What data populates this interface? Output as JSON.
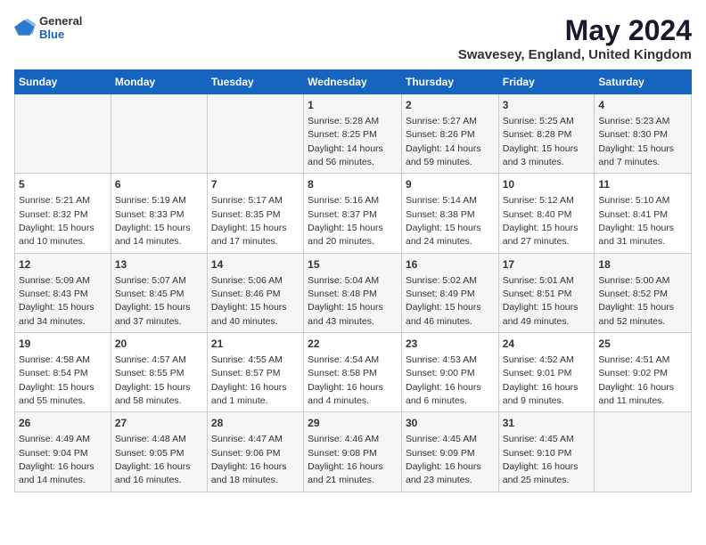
{
  "logo": {
    "general": "General",
    "blue": "Blue"
  },
  "header": {
    "month": "May 2024",
    "location": "Swavesey, England, United Kingdom"
  },
  "weekdays": [
    "Sunday",
    "Monday",
    "Tuesday",
    "Wednesday",
    "Thursday",
    "Friday",
    "Saturday"
  ],
  "weeks": [
    [
      {
        "day": "",
        "info": ""
      },
      {
        "day": "",
        "info": ""
      },
      {
        "day": "",
        "info": ""
      },
      {
        "day": "1",
        "info": "Sunrise: 5:28 AM\nSunset: 8:25 PM\nDaylight: 14 hours and 56 minutes."
      },
      {
        "day": "2",
        "info": "Sunrise: 5:27 AM\nSunset: 8:26 PM\nDaylight: 14 hours and 59 minutes."
      },
      {
        "day": "3",
        "info": "Sunrise: 5:25 AM\nSunset: 8:28 PM\nDaylight: 15 hours and 3 minutes."
      },
      {
        "day": "4",
        "info": "Sunrise: 5:23 AM\nSunset: 8:30 PM\nDaylight: 15 hours and 7 minutes."
      }
    ],
    [
      {
        "day": "5",
        "info": "Sunrise: 5:21 AM\nSunset: 8:32 PM\nDaylight: 15 hours and 10 minutes."
      },
      {
        "day": "6",
        "info": "Sunrise: 5:19 AM\nSunset: 8:33 PM\nDaylight: 15 hours and 14 minutes."
      },
      {
        "day": "7",
        "info": "Sunrise: 5:17 AM\nSunset: 8:35 PM\nDaylight: 15 hours and 17 minutes."
      },
      {
        "day": "8",
        "info": "Sunrise: 5:16 AM\nSunset: 8:37 PM\nDaylight: 15 hours and 20 minutes."
      },
      {
        "day": "9",
        "info": "Sunrise: 5:14 AM\nSunset: 8:38 PM\nDaylight: 15 hours and 24 minutes."
      },
      {
        "day": "10",
        "info": "Sunrise: 5:12 AM\nSunset: 8:40 PM\nDaylight: 15 hours and 27 minutes."
      },
      {
        "day": "11",
        "info": "Sunrise: 5:10 AM\nSunset: 8:41 PM\nDaylight: 15 hours and 31 minutes."
      }
    ],
    [
      {
        "day": "12",
        "info": "Sunrise: 5:09 AM\nSunset: 8:43 PM\nDaylight: 15 hours and 34 minutes."
      },
      {
        "day": "13",
        "info": "Sunrise: 5:07 AM\nSunset: 8:45 PM\nDaylight: 15 hours and 37 minutes."
      },
      {
        "day": "14",
        "info": "Sunrise: 5:06 AM\nSunset: 8:46 PM\nDaylight: 15 hours and 40 minutes."
      },
      {
        "day": "15",
        "info": "Sunrise: 5:04 AM\nSunset: 8:48 PM\nDaylight: 15 hours and 43 minutes."
      },
      {
        "day": "16",
        "info": "Sunrise: 5:02 AM\nSunset: 8:49 PM\nDaylight: 15 hours and 46 minutes."
      },
      {
        "day": "17",
        "info": "Sunrise: 5:01 AM\nSunset: 8:51 PM\nDaylight: 15 hours and 49 minutes."
      },
      {
        "day": "18",
        "info": "Sunrise: 5:00 AM\nSunset: 8:52 PM\nDaylight: 15 hours and 52 minutes."
      }
    ],
    [
      {
        "day": "19",
        "info": "Sunrise: 4:58 AM\nSunset: 8:54 PM\nDaylight: 15 hours and 55 minutes."
      },
      {
        "day": "20",
        "info": "Sunrise: 4:57 AM\nSunset: 8:55 PM\nDaylight: 15 hours and 58 minutes."
      },
      {
        "day": "21",
        "info": "Sunrise: 4:55 AM\nSunset: 8:57 PM\nDaylight: 16 hours and 1 minute."
      },
      {
        "day": "22",
        "info": "Sunrise: 4:54 AM\nSunset: 8:58 PM\nDaylight: 16 hours and 4 minutes."
      },
      {
        "day": "23",
        "info": "Sunrise: 4:53 AM\nSunset: 9:00 PM\nDaylight: 16 hours and 6 minutes."
      },
      {
        "day": "24",
        "info": "Sunrise: 4:52 AM\nSunset: 9:01 PM\nDaylight: 16 hours and 9 minutes."
      },
      {
        "day": "25",
        "info": "Sunrise: 4:51 AM\nSunset: 9:02 PM\nDaylight: 16 hours and 11 minutes."
      }
    ],
    [
      {
        "day": "26",
        "info": "Sunrise: 4:49 AM\nSunset: 9:04 PM\nDaylight: 16 hours and 14 minutes."
      },
      {
        "day": "27",
        "info": "Sunrise: 4:48 AM\nSunset: 9:05 PM\nDaylight: 16 hours and 16 minutes."
      },
      {
        "day": "28",
        "info": "Sunrise: 4:47 AM\nSunset: 9:06 PM\nDaylight: 16 hours and 18 minutes."
      },
      {
        "day": "29",
        "info": "Sunrise: 4:46 AM\nSunset: 9:08 PM\nDaylight: 16 hours and 21 minutes."
      },
      {
        "day": "30",
        "info": "Sunrise: 4:45 AM\nSunset: 9:09 PM\nDaylight: 16 hours and 23 minutes."
      },
      {
        "day": "31",
        "info": "Sunrise: 4:45 AM\nSunset: 9:10 PM\nDaylight: 16 hours and 25 minutes."
      },
      {
        "day": "",
        "info": ""
      }
    ]
  ]
}
